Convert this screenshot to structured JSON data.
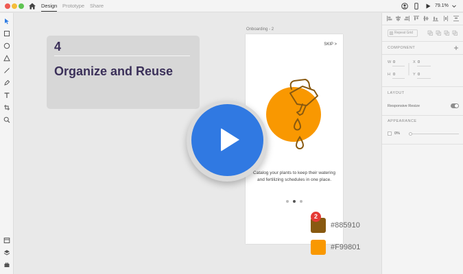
{
  "topbar": {
    "tabs": [
      {
        "label": "Design",
        "active": true
      },
      {
        "label": "Prototype",
        "active": false
      },
      {
        "label": "Share",
        "active": false
      }
    ],
    "zoom": "79.1%"
  },
  "right_panel": {
    "repeat_grid_label": "Repeat Grid",
    "component_title": "COMPONENT",
    "w_label": "W",
    "w_value": "0",
    "h_label": "H",
    "h_value": "0",
    "x_label": "X",
    "x_value": "0",
    "y_label": "Y",
    "y_value": "0",
    "layout_title": "LAYOUT",
    "responsive_label": "Responsive Resize",
    "appearance_title": "APPEARANCE",
    "opacity_value": "0%"
  },
  "title_card": {
    "number": "4",
    "title": "Organize and Reuse"
  },
  "artboard": {
    "label": "Onboarding - 2",
    "skip": "SKIP >",
    "caption": "Catalog your plants to keep their watering and fertilizing schedules in one place.",
    "page_count": 3,
    "active_page": 2
  },
  "swatches": {
    "badge_count": "2",
    "brown_hex": "#885910",
    "orange_hex": "#F99801"
  },
  "colors": {
    "accent_blue": "#3079e2",
    "title_purple": "#3b3059",
    "brown": "#885910",
    "orange": "#f99801"
  }
}
